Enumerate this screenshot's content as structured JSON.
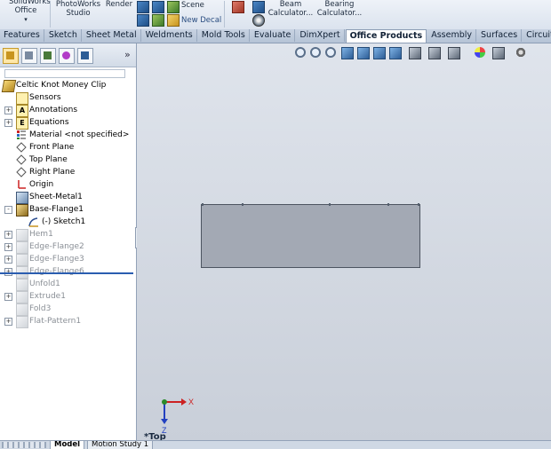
{
  "ribbon": {
    "office": "SolidWorks\nOffice",
    "photoworks": "PhotoWorks\nStudio",
    "render": "Render",
    "scene": "Scene",
    "new_decal": "New Decal",
    "beam": "Beam\nCalculator...",
    "bearing": "Bearing\nCalculator..."
  },
  "tabs": [
    "Features",
    "Sketch",
    "Sheet Metal",
    "Weldments",
    "Mold Tools",
    "Evaluate",
    "DimXpert",
    "Office Products",
    "Assembly",
    "Surfaces",
    "CircuitWorks"
  ],
  "active_tab": "Office Products",
  "panel": {
    "expand": "»"
  },
  "tree": [
    {
      "label": "Celtic Knot Money Clip",
      "icon": "part",
      "level": 0,
      "exp": "",
      "dim": false
    },
    {
      "label": "Sensors",
      "icon": "sensor",
      "level": 1,
      "exp": "",
      "dim": false
    },
    {
      "label": "Annotations",
      "icon": "annot",
      "level": 1,
      "exp": "+",
      "dim": false,
      "glyph": "A"
    },
    {
      "label": "Equations",
      "icon": "eq",
      "level": 1,
      "exp": "+",
      "dim": false,
      "glyph": "E"
    },
    {
      "label": "Material <not specified>",
      "icon": "mat",
      "level": 1,
      "exp": "",
      "dim": false
    },
    {
      "label": "Front Plane",
      "icon": "plane",
      "level": 1,
      "exp": "",
      "dim": false
    },
    {
      "label": "Top Plane",
      "icon": "plane",
      "level": 1,
      "exp": "",
      "dim": false
    },
    {
      "label": "Right Plane",
      "icon": "plane",
      "level": 1,
      "exp": "",
      "dim": false
    },
    {
      "label": "Origin",
      "icon": "origin",
      "level": 1,
      "exp": "",
      "dim": false
    },
    {
      "label": "Sheet-Metal1",
      "icon": "sheet",
      "level": 1,
      "exp": "",
      "dim": false
    },
    {
      "label": "Base-Flange1",
      "icon": "flange",
      "level": 1,
      "exp": "-",
      "dim": false
    },
    {
      "label": "(-) Sketch1",
      "icon": "sketch",
      "level": 2,
      "exp": "",
      "dim": false
    },
    {
      "label": "Hem1",
      "icon": "gray",
      "level": 1,
      "exp": "+",
      "dim": true
    },
    {
      "label": "Edge-Flange2",
      "icon": "gray",
      "level": 1,
      "exp": "+",
      "dim": true
    },
    {
      "label": "Edge-Flange3",
      "icon": "gray",
      "level": 1,
      "exp": "+",
      "dim": true
    },
    {
      "label": "Edge-Flange6",
      "icon": "gray",
      "level": 1,
      "exp": "+",
      "dim": true
    },
    {
      "label": "Unfold1",
      "icon": "gray",
      "level": 1,
      "exp": "",
      "dim": true
    },
    {
      "label": "Extrude1",
      "icon": "gray",
      "level": 1,
      "exp": "+",
      "dim": true
    },
    {
      "label": "Fold3",
      "icon": "gray",
      "level": 1,
      "exp": "",
      "dim": true
    },
    {
      "label": "Flat-Pattern1",
      "icon": "gray",
      "level": 1,
      "exp": "+",
      "dim": true
    }
  ],
  "bottom_tabs": [
    "Model",
    "Motion Study 1"
  ],
  "viewport": {
    "view_name": "*Top",
    "axis_x": "X",
    "axis_z": "Z"
  }
}
